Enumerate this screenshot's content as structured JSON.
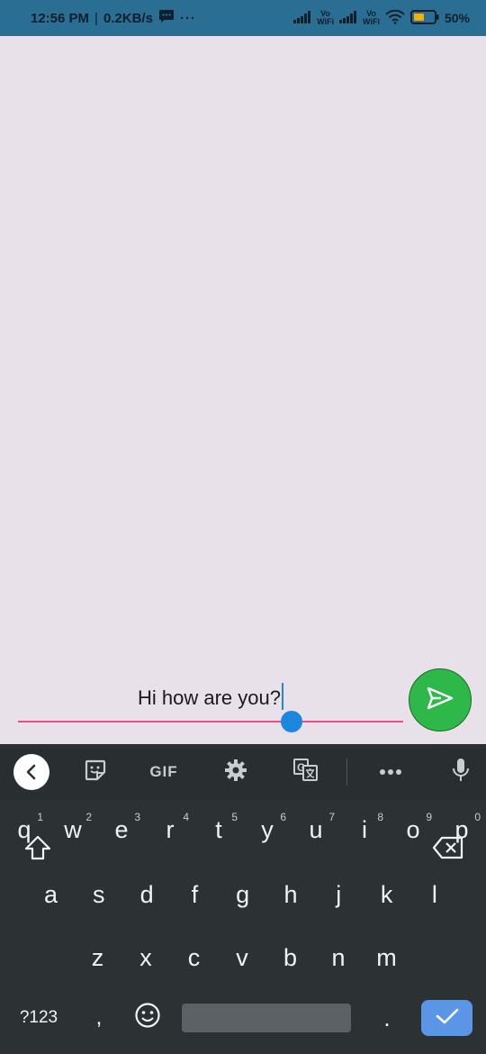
{
  "status_bar": {
    "time": "12:56 PM",
    "separator": "|",
    "speed": "0.2KB/s",
    "more": "···",
    "volte_1": "Vo",
    "wifi_1": "WiFi",
    "volte_2": "Vo",
    "wifi_2": "WiFi",
    "battery": "50%"
  },
  "composer": {
    "text": "Hi how are you?"
  },
  "keyboard_toolbar": {
    "gif_label": "GIF"
  },
  "keyboard": {
    "row1": [
      {
        "key": "q",
        "hint": "1"
      },
      {
        "key": "w",
        "hint": "2"
      },
      {
        "key": "e",
        "hint": "3"
      },
      {
        "key": "r",
        "hint": "4"
      },
      {
        "key": "t",
        "hint": "5"
      },
      {
        "key": "y",
        "hint": "6"
      },
      {
        "key": "u",
        "hint": "7"
      },
      {
        "key": "i",
        "hint": "8"
      },
      {
        "key": "o",
        "hint": "9"
      },
      {
        "key": "p",
        "hint": "0"
      }
    ],
    "row2": [
      "a",
      "s",
      "d",
      "f",
      "g",
      "h",
      "j",
      "k",
      "l"
    ],
    "row3": [
      "z",
      "x",
      "c",
      "v",
      "b",
      "n",
      "m"
    ],
    "symbols_label": "?123",
    "comma": ",",
    "period": "."
  },
  "colors": {
    "accent_underline": "#e84f86",
    "send_button": "#2eb84a",
    "enter_key": "#5a95e6",
    "status_bar": "#2a6f93"
  }
}
